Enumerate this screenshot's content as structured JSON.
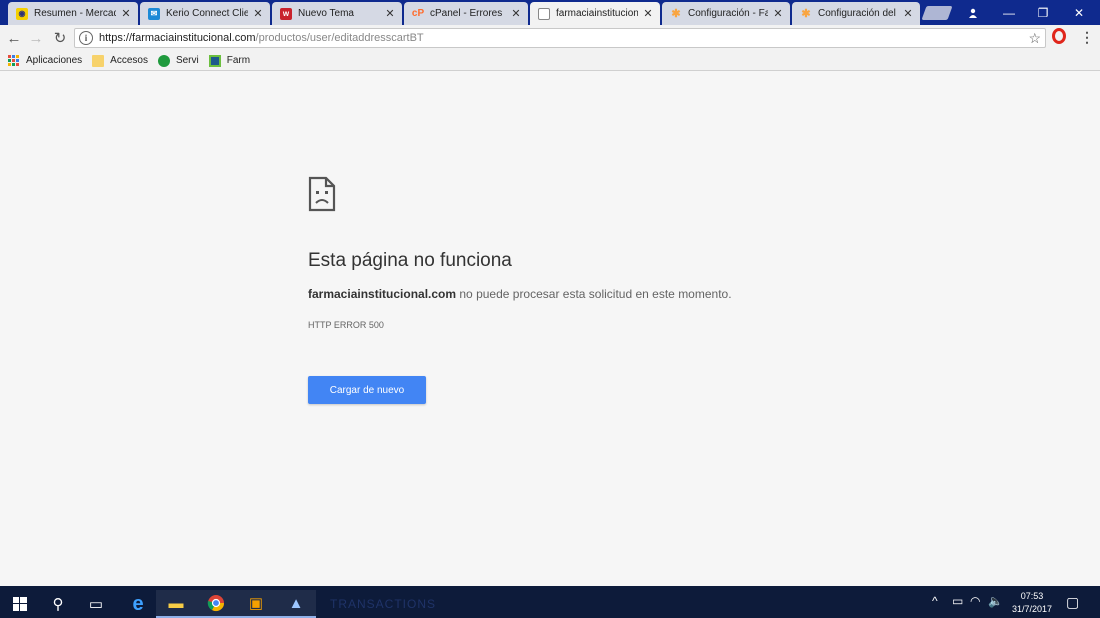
{
  "tabs": [
    {
      "title": "Resumen - Mercad",
      "favicon": "mercadolibre-icon",
      "color": "#f5d000"
    },
    {
      "title": "Kerio Connect Clie",
      "favicon": "kerio-mail-icon",
      "color": "#1d8ad6"
    },
    {
      "title": "Nuevo Tema",
      "favicon": "forum-icon",
      "color": "#c9232d"
    },
    {
      "title": "cPanel - Errores",
      "favicon": "cpanel-icon",
      "color": "#ff6c2c"
    },
    {
      "title": "farmaciainstitucion",
      "favicon": "page-icon",
      "color": "#ffffff",
      "active": true
    },
    {
      "title": "Configuración - Fa",
      "favicon": "joomla-icon",
      "color": "#f9a541"
    },
    {
      "title": "Configuración del",
      "favicon": "joomla-icon",
      "color": "#f9a541"
    }
  ],
  "address_bar": {
    "url_host": "https://farmaciainstitucional.com",
    "url_path": "/productos/user/editaddresscartBT"
  },
  "bookmarks": [
    {
      "label": "Aplicaciones",
      "icon": "apps-grid-icon"
    },
    {
      "label": "Accesos",
      "icon": "folder-icon"
    },
    {
      "label": "Servi",
      "icon": "servi-icon"
    },
    {
      "label": "Farm",
      "icon": "farm-icon"
    }
  ],
  "error_page": {
    "title": "Esta página no funciona",
    "domain": "farmaciainstitucional.com",
    "message": " no puede procesar esta solicitud en este momento.",
    "code": "HTTP ERROR 500",
    "reload_label": "Cargar de nuevo"
  },
  "taskbar": {
    "ghost_text": "TRANSACTIONS",
    "time": "07:53",
    "date": "31/7/2017"
  },
  "colors": {
    "tabstrip": "#0f2a8e",
    "taskbar": "#0d1b3a",
    "button": "#4285f4"
  }
}
